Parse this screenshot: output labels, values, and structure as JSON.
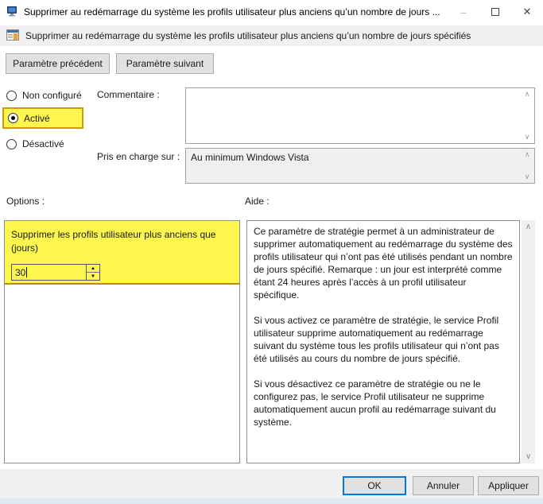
{
  "window": {
    "title": "Supprimer au redémarrage du système les profils utilisateur plus anciens qu’un nombre de jours ...",
    "controls": {
      "minimize": "–",
      "close": "✕"
    }
  },
  "policy_header": {
    "title": "Supprimer au redémarrage du système les profils utilisateur plus anciens qu’un nombre de jours spécifiés"
  },
  "nav_buttons": {
    "previous": "Paramètre précédent",
    "next": "Paramètre suivant"
  },
  "state_options": {
    "not_configured": "Non configuré",
    "enabled": "Activé",
    "disabled": "Désactivé",
    "selected": "Activé"
  },
  "comment": {
    "label": "Commentaire :",
    "value": ""
  },
  "supported_on": {
    "label": "Pris en charge sur :",
    "value": "Au minimum Windows Vista"
  },
  "options_section": {
    "label": "Options :",
    "setting_label_line1": "Supprimer les profils utilisateur plus anciens que",
    "setting_label_line2": "(jours)",
    "days_value": "30"
  },
  "help_section": {
    "label": "Aide :",
    "paragraphs": [
      "Ce paramètre de stratégie permet à un administrateur de supprimer automatiquement au redémarrage du système des profils utilisateur qui n’ont pas été utilisés pendant un nombre de jours spécifié. Remarque : un jour est interprété comme étant 24 heures après l’accès à un profil utilisateur spécifique.",
      "Si vous activez ce paramètre de stratégie, le service Profil utilisateur supprime automatiquement au redémarrage suivant du système tous les profils utilisateur qui n’ont pas été utilisés au cours du nombre de jours spécifié.",
      "Si vous désactivez ce paramètre de stratégie ou ne le configurez pas, le service Profil utilisateur ne supprime automatiquement aucun profil au redémarrage suivant du système."
    ]
  },
  "footer": {
    "ok": "OK",
    "cancel": "Annuler",
    "apply": "Appliquer"
  },
  "colors": {
    "highlight": "#fcf64e",
    "highlight_border": "#cf9d00",
    "ok_border": "#0078d7",
    "header_bg": "#f0f0f0"
  }
}
